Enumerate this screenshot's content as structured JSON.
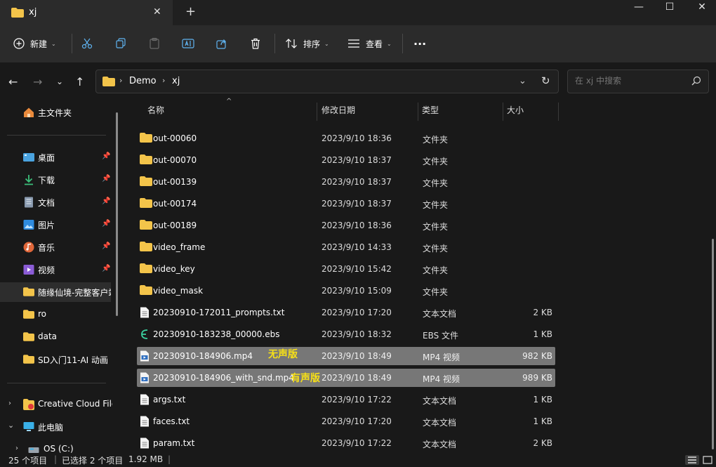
{
  "window": {
    "tab_title": "xj",
    "tab_close": "✕",
    "new_tab": "+",
    "minimize": "—",
    "maximize": "☐",
    "close": "✕"
  },
  "toolbar": {
    "new_label": "新建",
    "sort_label": "排序",
    "view_label": "查看",
    "more_label": "···"
  },
  "address": {
    "crumbs": [
      "Demo",
      "xj"
    ],
    "search_placeholder": "在 xj 中搜索"
  },
  "sidebar": {
    "home": "主文件夹",
    "pinned": [
      {
        "label": "桌面",
        "icon": "desktop-icon",
        "color": "#4aa3df"
      },
      {
        "label": "下载",
        "icon": "download-icon",
        "color": "#3bbf7a"
      },
      {
        "label": "文档",
        "icon": "document-icon",
        "color": "#8a9bb0"
      },
      {
        "label": "图片",
        "icon": "pictures-icon",
        "color": "#2f8ce0"
      },
      {
        "label": "音乐",
        "icon": "music-icon",
        "color": "#e0673a"
      },
      {
        "label": "视频",
        "icon": "video-icon",
        "color": "#8b5cd6"
      }
    ],
    "folders": [
      "随缘仙境-完整客户端",
      "ro",
      "data",
      "SD入门11-AI 动画"
    ],
    "creative_cloud": "Creative Cloud Files",
    "this_pc": "此电脑",
    "os_drive": "OS (C:)"
  },
  "columns": {
    "name": "名称",
    "date": "修改日期",
    "type": "类型",
    "size": "大小"
  },
  "files": [
    {
      "name": "out-00060",
      "date": "2023/9/10 18:36",
      "type": "文件夹",
      "size": "",
      "icon": "folder-icon",
      "selected": false
    },
    {
      "name": "out-00070",
      "date": "2023/9/10 18:37",
      "type": "文件夹",
      "size": "",
      "icon": "folder-icon",
      "selected": false
    },
    {
      "name": "out-00139",
      "date": "2023/9/10 18:37",
      "type": "文件夹",
      "size": "",
      "icon": "folder-icon",
      "selected": false
    },
    {
      "name": "out-00174",
      "date": "2023/9/10 18:37",
      "type": "文件夹",
      "size": "",
      "icon": "folder-icon",
      "selected": false
    },
    {
      "name": "out-00189",
      "date": "2023/9/10 18:36",
      "type": "文件夹",
      "size": "",
      "icon": "folder-icon",
      "selected": false
    },
    {
      "name": "video_frame",
      "date": "2023/9/10 14:33",
      "type": "文件夹",
      "size": "",
      "icon": "folder-icon",
      "selected": false
    },
    {
      "name": "video_key",
      "date": "2023/9/10 15:42",
      "type": "文件夹",
      "size": "",
      "icon": "folder-icon",
      "selected": false
    },
    {
      "name": "video_mask",
      "date": "2023/9/10 15:09",
      "type": "文件夹",
      "size": "",
      "icon": "folder-icon",
      "selected": false
    },
    {
      "name": "20230910-172011_prompts.txt",
      "date": "2023/9/10 17:20",
      "type": "文本文档",
      "size": "2 KB",
      "icon": "text-file-icon",
      "selected": false
    },
    {
      "name": "20230910-183238_00000.ebs",
      "date": "2023/9/10 18:32",
      "type": "EBS 文件",
      "size": "1 KB",
      "icon": "ebs-file-icon",
      "selected": false
    },
    {
      "name": "20230910-184906.mp4",
      "date": "2023/9/10 18:49",
      "type": "MP4 视频",
      "size": "982 KB",
      "icon": "video-file-icon",
      "selected": true
    },
    {
      "name": "20230910-184906_with_snd.mp4",
      "date": "2023/9/10 18:49",
      "type": "MP4 视频",
      "size": "989 KB",
      "icon": "video-file-icon",
      "selected": true
    },
    {
      "name": "args.txt",
      "date": "2023/9/10 17:22",
      "type": "文本文档",
      "size": "1 KB",
      "icon": "text-file-icon",
      "selected": false
    },
    {
      "name": "faces.txt",
      "date": "2023/9/10 17:20",
      "type": "文本文档",
      "size": "1 KB",
      "icon": "text-file-icon",
      "selected": false
    },
    {
      "name": "param.txt",
      "date": "2023/9/10 17:22",
      "type": "文本文档",
      "size": "2 KB",
      "icon": "text-file-icon",
      "selected": false
    }
  ],
  "annotations": {
    "no_sound": "无声版",
    "with_sound": "有声版",
    "color": "#f7e017"
  },
  "status": {
    "item_count": "25 个项目",
    "selection": "已选择 2 个项目",
    "size": "1.92 MB"
  },
  "colors": {
    "background": "#191919",
    "panel": "#2b2b2b",
    "selected_row": "#777777",
    "folder": "#f3c44a"
  }
}
